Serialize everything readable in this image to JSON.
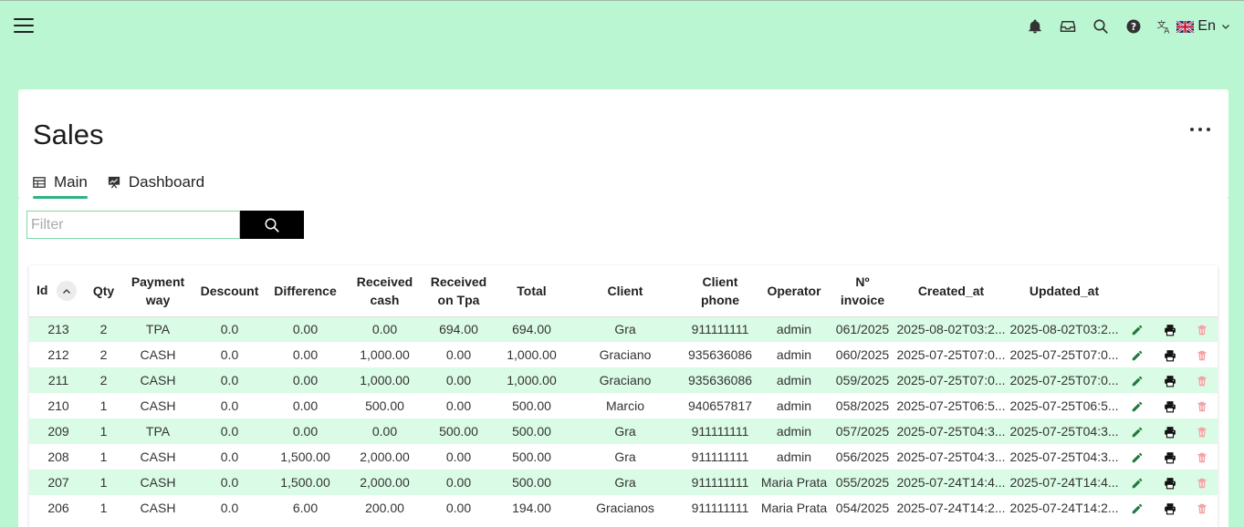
{
  "header": {
    "menu_icon": "hamburger-menu-icon",
    "icons": [
      "bell-icon",
      "inbox-icon",
      "search-icon",
      "help-icon"
    ],
    "language": {
      "icon": "translate-icon",
      "flag": "uk-flag-icon",
      "code": "En"
    }
  },
  "page": {
    "title": "Sales",
    "tabs": [
      {
        "label": "Main",
        "icon": "table-icon"
      },
      {
        "label": "Dashboard",
        "icon": "chart-icon"
      }
    ]
  },
  "filter": {
    "placeholder": "Filter",
    "value": ""
  },
  "table": {
    "columns": {
      "id": "Id",
      "qty": "Qty",
      "payment_way_1": "Payment",
      "payment_way_2": "way",
      "descount": "Descount",
      "difference": "Difference",
      "received_cash_1": "Received",
      "received_cash_2": "cash",
      "received_tpa_1": "Received",
      "received_tpa_2": "on Tpa",
      "total": "Total",
      "client": "Client",
      "client_phone_1": "Client",
      "client_phone_2": "phone",
      "operator": "Operator",
      "invoice_1": "Nº",
      "invoice_2": "invoice",
      "created_at": "Created_at",
      "updated_at": "Updated_at"
    },
    "rows": [
      {
        "id": "213",
        "qty": "2",
        "payment": "TPA",
        "descount": "0.0",
        "difference": "0.00",
        "cash": "0.00",
        "tpa": "694.00",
        "total": "694.00",
        "client": "Gra",
        "phone": "911111111",
        "operator": "admin",
        "invoice": "061/2025",
        "created": "2025-08-02T03:2...",
        "updated": "2025-08-02T03:2..."
      },
      {
        "id": "212",
        "qty": "2",
        "payment": "CASH",
        "descount": "0.0",
        "difference": "0.00",
        "cash": "1,000.00",
        "tpa": "0.00",
        "total": "1,000.00",
        "client": "Graciano",
        "phone": "935636086",
        "operator": "admin",
        "invoice": "060/2025",
        "created": "2025-07-25T07:0...",
        "updated": "2025-07-25T07:0..."
      },
      {
        "id": "211",
        "qty": "2",
        "payment": "CASH",
        "descount": "0.0",
        "difference": "0.00",
        "cash": "1,000.00",
        "tpa": "0.00",
        "total": "1,000.00",
        "client": "Graciano",
        "phone": "935636086",
        "operator": "admin",
        "invoice": "059/2025",
        "created": "2025-07-25T07:0...",
        "updated": "2025-07-25T07:0..."
      },
      {
        "id": "210",
        "qty": "1",
        "payment": "CASH",
        "descount": "0.0",
        "difference": "0.00",
        "cash": "500.00",
        "tpa": "0.00",
        "total": "500.00",
        "client": "Marcio",
        "phone": "940657817",
        "operator": "admin",
        "invoice": "058/2025",
        "created": "2025-07-25T06:5...",
        "updated": "2025-07-25T06:5..."
      },
      {
        "id": "209",
        "qty": "1",
        "payment": "TPA",
        "descount": "0.0",
        "difference": "0.00",
        "cash": "0.00",
        "tpa": "500.00",
        "total": "500.00",
        "client": "Gra",
        "phone": "911111111",
        "operator": "admin",
        "invoice": "057/2025",
        "created": "2025-07-25T04:3...",
        "updated": "2025-07-25T04:3..."
      },
      {
        "id": "208",
        "qty": "1",
        "payment": "CASH",
        "descount": "0.0",
        "difference": "1,500.00",
        "cash": "2,000.00",
        "tpa": "0.00",
        "total": "500.00",
        "client": "Gra",
        "phone": "911111111",
        "operator": "admin",
        "invoice": "056/2025",
        "created": "2025-07-25T04:3...",
        "updated": "2025-07-25T04:3..."
      },
      {
        "id": "207",
        "qty": "1",
        "payment": "CASH",
        "descount": "0.0",
        "difference": "1,500.00",
        "cash": "2,000.00",
        "tpa": "0.00",
        "total": "500.00",
        "client": "Gra",
        "phone": "911111111",
        "operator": "Maria Prata",
        "invoice": "055/2025",
        "created": "2025-07-24T14:4...",
        "updated": "2025-07-24T14:4..."
      },
      {
        "id": "206",
        "qty": "1",
        "payment": "CASH",
        "descount": "0.0",
        "difference": "6.00",
        "cash": "200.00",
        "tpa": "0.00",
        "total": "194.00",
        "client": "Gracianos",
        "phone": "911111111",
        "operator": "Maria Prata",
        "invoice": "054/2025",
        "created": "2025-07-24T14:2...",
        "updated": "2025-07-24T14:2..."
      }
    ],
    "row_actions": [
      "edit-icon",
      "print-icon",
      "delete-icon"
    ]
  },
  "colors": {
    "background": "#bbf6d2",
    "accent": "#2db37f",
    "row_stripe": "#dafbe5",
    "edit": "#1e7a3a",
    "delete": "#f4a3a3"
  }
}
